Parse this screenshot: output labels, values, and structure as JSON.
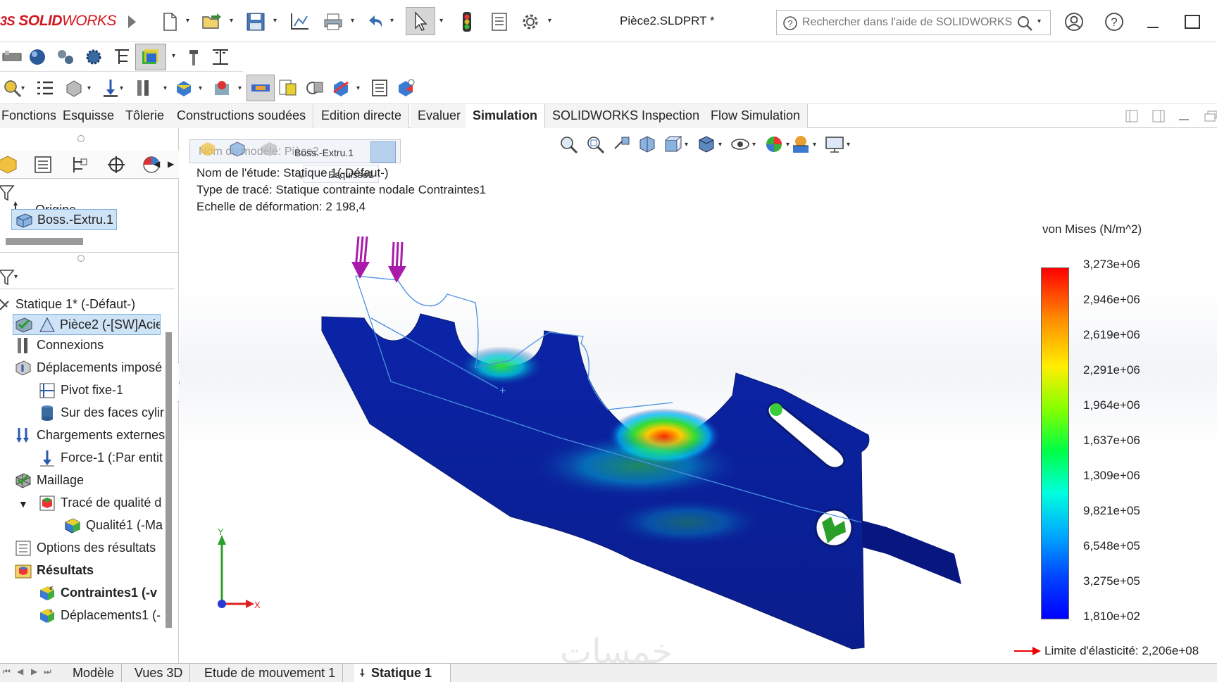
{
  "app": {
    "brand_prefix": "3S",
    "brand_bold": "SOLID",
    "brand_light": "WORKS",
    "document_title": "Pièce2.SLDPRT *"
  },
  "search": {
    "placeholder": "Rechercher dans l'aide de SOLIDWORKS"
  },
  "command_tabs": [
    {
      "label": "Fonctions",
      "active": false
    },
    {
      "label": "Esquisse",
      "active": false
    },
    {
      "label": "Tôlerie",
      "active": false
    },
    {
      "label": "Constructions soudées",
      "active": false
    },
    {
      "label": "Edition directe",
      "active": false
    },
    {
      "label": "Evaluer",
      "active": false
    },
    {
      "label": "Simulation",
      "active": true
    },
    {
      "label": "SOLIDWORKS Inspection",
      "active": false
    },
    {
      "label": "Flow Simulation",
      "active": false
    }
  ],
  "feature_tree": {
    "items": [
      {
        "label": "Origine",
        "icon": "origin-icon"
      },
      {
        "label": "Boss.-Extru.1",
        "icon": "extrude-icon",
        "selected": true
      }
    ]
  },
  "simulation_tree": {
    "items": [
      {
        "label": "Statique 1* (-Défaut-)",
        "icon": "study-icon",
        "level": 0
      },
      {
        "label": "Pièce2 (-[SW]Acie",
        "icon": "part-material-icon",
        "level": 1,
        "selected": true
      },
      {
        "label": "Connexions",
        "icon": "connections-icon",
        "level": 0
      },
      {
        "label": "Déplacements imposé",
        "icon": "fixtures-icon",
        "level": 0
      },
      {
        "label": "Pivot fixe-1",
        "icon": "fixed-hinge-icon",
        "level": 1
      },
      {
        "label": "Sur des faces cylir",
        "icon": "cylinder-icon",
        "level": 1
      },
      {
        "label": "Chargements externes",
        "icon": "loads-icon",
        "level": 0
      },
      {
        "label": "Force-1 (:Par entit",
        "icon": "force-arrow-icon",
        "level": 1
      },
      {
        "label": "Maillage",
        "icon": "mesh-icon",
        "level": 0
      },
      {
        "label": "Tracé de qualité d",
        "icon": "quality-plot-icon",
        "level": 1
      },
      {
        "label": "Qualité1 (-Ma",
        "icon": "quality-icon",
        "level": 2
      },
      {
        "label": "Options des résultats",
        "icon": "result-options-icon",
        "level": 0
      },
      {
        "label": "Résultats",
        "icon": "results-folder-icon",
        "level": 0,
        "bold": true
      },
      {
        "label": "Contraintes1 (-v",
        "icon": "stress-plot-icon",
        "level": 1,
        "bold": true
      },
      {
        "label": "Déplacements1 (-",
        "icon": "displacement-plot-icon",
        "level": 1
      }
    ]
  },
  "breadcrumb": {
    "model_name_label": "Nom du modèle: Pièce2",
    "feature": "Boss.-Extru.1",
    "sketch": "Esquisse1"
  },
  "plot_info": {
    "study_name": "Nom de l'étude: Statique 1(-Défaut-)",
    "plot_type": "Type de tracé: Statique contrainte nodale Contraintes1",
    "deformation_scale": "Echelle de déformation: 2 198,4"
  },
  "legend": {
    "title": "von Mises (N/m^2)",
    "ticks": [
      "3,273e+06",
      "2,946e+06",
      "2,619e+06",
      "2,291e+06",
      "1,964e+06",
      "1,637e+06",
      "1,309e+06",
      "9,821e+05",
      "6,548e+05",
      "3,275e+05",
      "1,810e+02"
    ],
    "yield_label": "Limite d'élasticité: 2,206e+08",
    "colors": {
      "max": "#ff0000",
      "high": "#ffa500",
      "mid_high": "#ffff00",
      "mid": "#00ff00",
      "mid_low": "#00ffff",
      "min": "#0000ff"
    }
  },
  "triad": {
    "x": "X",
    "y": "Y"
  },
  "bottom_tabs": [
    {
      "label": "Modèle",
      "active": false
    },
    {
      "label": "Vues 3D",
      "active": false
    },
    {
      "label": "Etude de mouvement 1",
      "active": false
    },
    {
      "label": "Statique 1",
      "active": true
    }
  ],
  "watermark": "خمسات"
}
